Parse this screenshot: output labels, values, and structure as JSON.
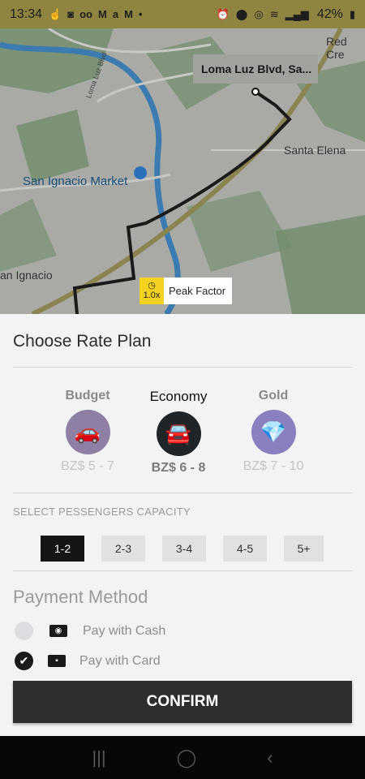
{
  "status_bar": {
    "time": "13:34",
    "left_icons": [
      "touch-icon",
      "app-icon",
      "voicemail-icon",
      "gmail-icon",
      "airtel-icon",
      "gmail-icon",
      "dot-icon"
    ],
    "right_icons": [
      "alarm-icon",
      "location-icon",
      "hotspot-icon",
      "wifi-icon",
      "signal-icon"
    ],
    "battery": "42%"
  },
  "map": {
    "destination": "Loma Luz Blvd, Sa...",
    "labels": {
      "red_creek": "Red Cre",
      "santa_elena": "Santa Elena",
      "san_ignacio_market": "San Ignacio Market",
      "san_ignacio": "an Ignacio",
      "loma_luz_road": "Loma Luz Blvd"
    },
    "peak": {
      "factor": "1.0x",
      "label": "Peak Factor"
    }
  },
  "sheet": {
    "title": "Choose Rate Plan",
    "plans": [
      {
        "name": "Budget",
        "price": "BZ$ 5 - 7"
      },
      {
        "name": "Economy",
        "price": "BZ$ 6 - 8"
      },
      {
        "name": "Gold",
        "price": "BZ$ 7 - 10"
      }
    ],
    "selected_plan": "Economy",
    "capacity_label": "SELECT PESSENGERS CAPACITY",
    "capacity_options": [
      "1-2",
      "2-3",
      "3-4",
      "4-5",
      "5+"
    ],
    "selected_capacity": "1-2",
    "payment_title": "Payment Method",
    "payment_options": [
      {
        "label": "Pay with Cash",
        "selected": false
      },
      {
        "label": "Pay with Card",
        "selected": true
      }
    ],
    "confirm_label": "CONFIRM"
  },
  "colors": {
    "peak_accent": "#f4d21f",
    "route": "#1a1a1a",
    "button": "#2e2e2e"
  }
}
